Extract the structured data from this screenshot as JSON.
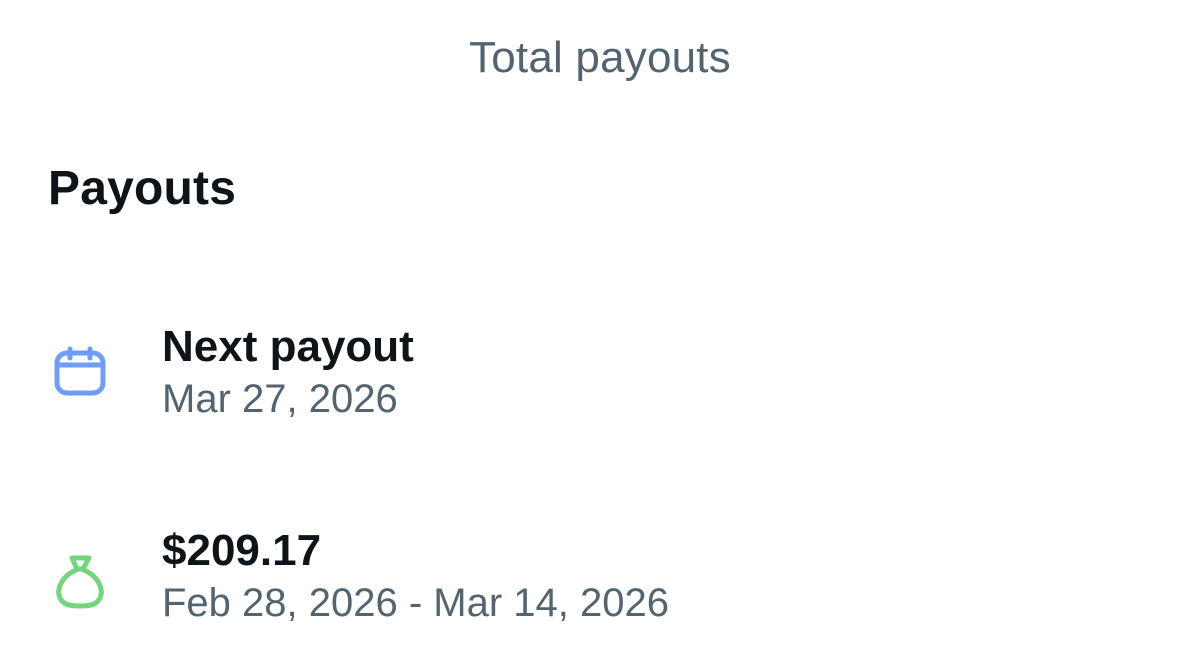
{
  "header": {
    "tab_label": "Total payouts"
  },
  "section": {
    "title": "Payouts"
  },
  "rows": [
    {
      "icon": "calendar-icon",
      "primary": "Next payout",
      "secondary": "Mar 27, 2026",
      "icon_color": "#6f9ef6"
    },
    {
      "icon": "money-bag-icon",
      "primary": "$209.17",
      "secondary": "Feb 28, 2026 - Mar 14, 2026",
      "icon_color": "#72d67c"
    }
  ],
  "colors": {
    "primary_text": "#0f1419",
    "secondary_text": "#536471",
    "background": "#ffffff"
  }
}
